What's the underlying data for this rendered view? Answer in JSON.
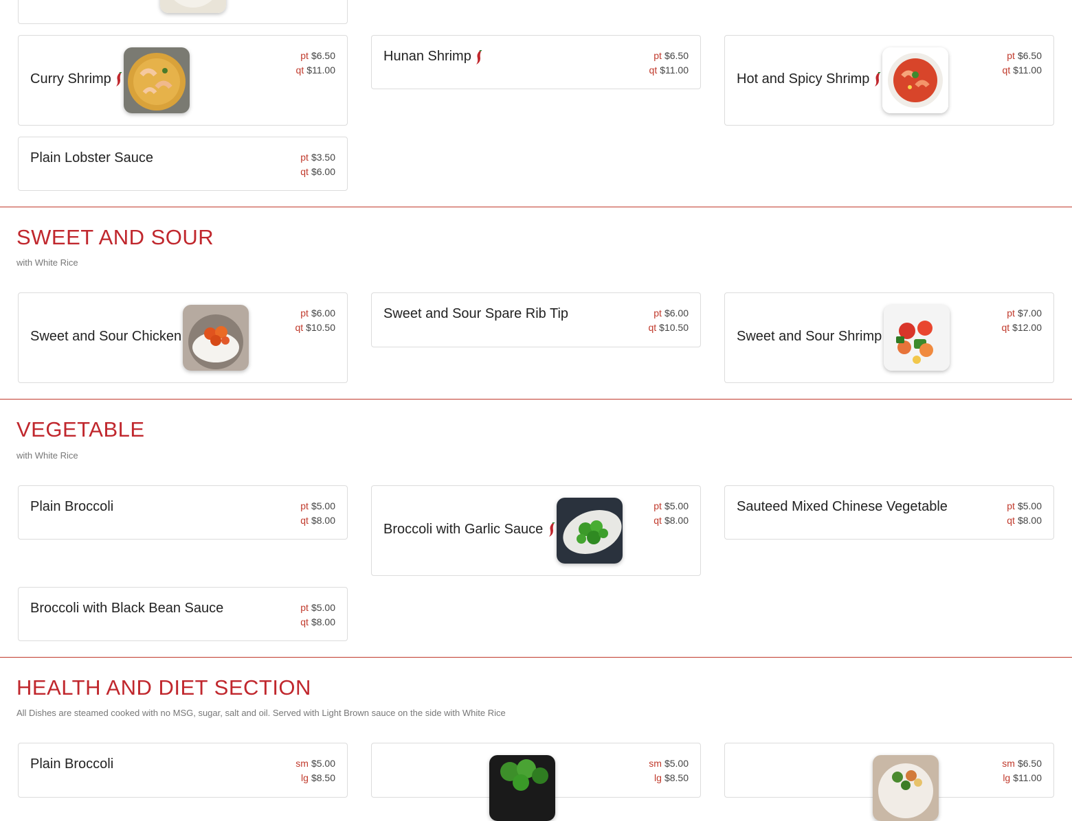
{
  "colors": {
    "accent": "#c0272d",
    "border": "#dcdcdc"
  },
  "seafood": {
    "items": [
      {
        "name": "Curry Shrimp",
        "spicy": true,
        "image": "curry-shrimp",
        "prices": [
          {
            "size": "pt",
            "price": "$6.50"
          },
          {
            "size": "qt",
            "price": "$11.00"
          }
        ]
      },
      {
        "name": "Hunan Shrimp",
        "spicy": true,
        "prices": [
          {
            "size": "pt",
            "price": "$6.50"
          },
          {
            "size": "qt",
            "price": "$11.00"
          }
        ]
      },
      {
        "name": "Hot and Spicy Shrimp",
        "spicy": true,
        "image": "hot-spicy-shrimp",
        "prices": [
          {
            "size": "pt",
            "price": "$6.50"
          },
          {
            "size": "qt",
            "price": "$11.00"
          }
        ]
      },
      {
        "name": "Plain Lobster Sauce",
        "spicy": false,
        "prices": [
          {
            "size": "pt",
            "price": "$3.50"
          },
          {
            "size": "qt",
            "price": "$6.00"
          }
        ]
      }
    ]
  },
  "sweet_sour": {
    "title": "SWEET AND SOUR",
    "subtitle": "with White Rice",
    "items": [
      {
        "name": "Sweet and Sour Chicken",
        "image": "sweet-sour-chicken",
        "prices": [
          {
            "size": "pt",
            "price": "$6.00"
          },
          {
            "size": "qt",
            "price": "$10.50"
          }
        ]
      },
      {
        "name": "Sweet and Sour Spare Rib Tip",
        "prices": [
          {
            "size": "pt",
            "price": "$6.00"
          },
          {
            "size": "qt",
            "price": "$10.50"
          }
        ]
      },
      {
        "name": "Sweet and Sour Shrimp",
        "image": "sweet-sour-shrimp",
        "prices": [
          {
            "size": "pt",
            "price": "$7.00"
          },
          {
            "size": "qt",
            "price": "$12.00"
          }
        ]
      }
    ]
  },
  "vegetable": {
    "title": "VEGETABLE",
    "subtitle": "with White Rice",
    "items": [
      {
        "name": "Plain Broccoli",
        "prices": [
          {
            "size": "pt",
            "price": "$5.00"
          },
          {
            "size": "qt",
            "price": "$8.00"
          }
        ]
      },
      {
        "name": "Broccoli with Garlic Sauce",
        "spicy": true,
        "image": "broccoli-garlic",
        "prices": [
          {
            "size": "pt",
            "price": "$5.00"
          },
          {
            "size": "qt",
            "price": "$8.00"
          }
        ]
      },
      {
        "name": "Sauteed Mixed Chinese Vegetable",
        "prices": [
          {
            "size": "pt",
            "price": "$5.00"
          },
          {
            "size": "qt",
            "price": "$8.00"
          }
        ]
      },
      {
        "name": "Broccoli with Black Bean Sauce",
        "prices": [
          {
            "size": "pt",
            "price": "$5.00"
          },
          {
            "size": "qt",
            "price": "$8.00"
          }
        ]
      }
    ]
  },
  "health": {
    "title": "HEALTH AND DIET SECTION",
    "subtitle": "All Dishes are steamed cooked with no MSG, sugar, salt and oil. Served with Light Brown sauce on the side with White Rice",
    "items": [
      {
        "name": "Plain Broccoli",
        "prices": [
          {
            "size": "sm",
            "price": "$5.00"
          },
          {
            "size": "lg",
            "price": "$8.50"
          }
        ]
      },
      {
        "name": "",
        "image": "steamed-broccoli",
        "prices": [
          {
            "size": "sm",
            "price": "$5.00"
          },
          {
            "size": "lg",
            "price": "$8.50"
          }
        ]
      },
      {
        "name": "",
        "image": "steamed-mixed",
        "prices": [
          {
            "size": "sm",
            "price": "$6.50"
          },
          {
            "size": "lg",
            "price": "$11.00"
          }
        ]
      }
    ]
  }
}
